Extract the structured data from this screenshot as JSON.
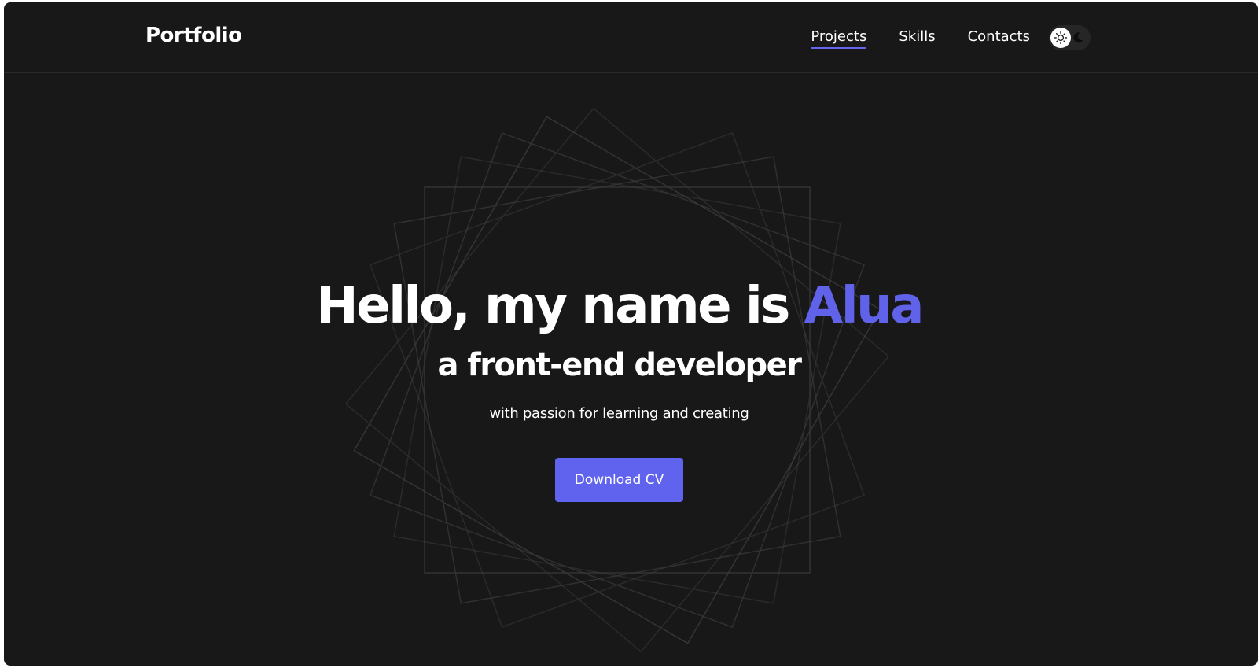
{
  "nav": {
    "logo": "Portfolio",
    "links": [
      {
        "label": "Projects",
        "active": true
      },
      {
        "label": "Skills",
        "active": false
      },
      {
        "label": "Contacts",
        "active": false
      }
    ],
    "theme_toggle": {
      "icons": [
        "sun-icon",
        "moon-icon"
      ],
      "selected": "light"
    }
  },
  "hero": {
    "greeting": "Hello, my name is ",
    "name": "Alua",
    "subtitle": "a front-end developer",
    "tagline": "with passion for learning and creating",
    "cta_label": "Download CV"
  },
  "colors": {
    "background": "#181818",
    "accent": "#6062ea",
    "button": "#5f63ee",
    "text": "#ffffff"
  }
}
